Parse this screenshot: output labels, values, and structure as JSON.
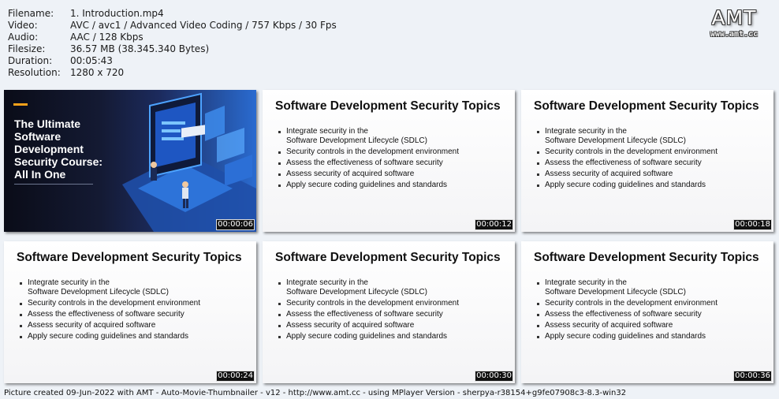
{
  "info": [
    {
      "key": "Filename:",
      "value": "1. Introduction.mp4"
    },
    {
      "key": "Video:",
      "value": "AVC / avc1 / Advanced Video Coding / 757 Kbps / 30 Fps"
    },
    {
      "key": "Audio:",
      "value": "AAC / 128 Kbps"
    },
    {
      "key": "Filesize:",
      "value": "36.57 MB (38.345.340 Bytes)"
    },
    {
      "key": "Duration:",
      "value": "00:05:43"
    },
    {
      "key": "Resolution:",
      "value": "1280 x 720"
    }
  ],
  "logo": {
    "text": "AMT",
    "url": "www.amt.cc"
  },
  "cover": {
    "title_lines": [
      "The Ultimate",
      "Software",
      "Development",
      "Security Course:",
      "All In One"
    ],
    "timestamp": "00:00:06"
  },
  "slide": {
    "title": "Software Development Security Topics",
    "bullet1_line1": "Integrate security in the",
    "bullet1_line2": "Software Development Lifecycle (SDLC)",
    "bullet2": "Security controls in the development environment",
    "bullet3": "Assess the effectiveness of software security",
    "bullet4": "Assess security of acquired software",
    "bullet5": "Apply secure coding guidelines and standards"
  },
  "timestamps": {
    "t2": "00:00:12",
    "t3": "00:00:18",
    "t4": "00:00:24",
    "t5": "00:00:30",
    "t6": "00:00:36"
  },
  "footer": "Picture created 09-Jun-2022 with AMT - Auto-Movie-Thumbnailer - v12 - http://www.amt.cc - using MPlayer Version - sherpya-r38154+g9fe07908c3-8.3-win32"
}
